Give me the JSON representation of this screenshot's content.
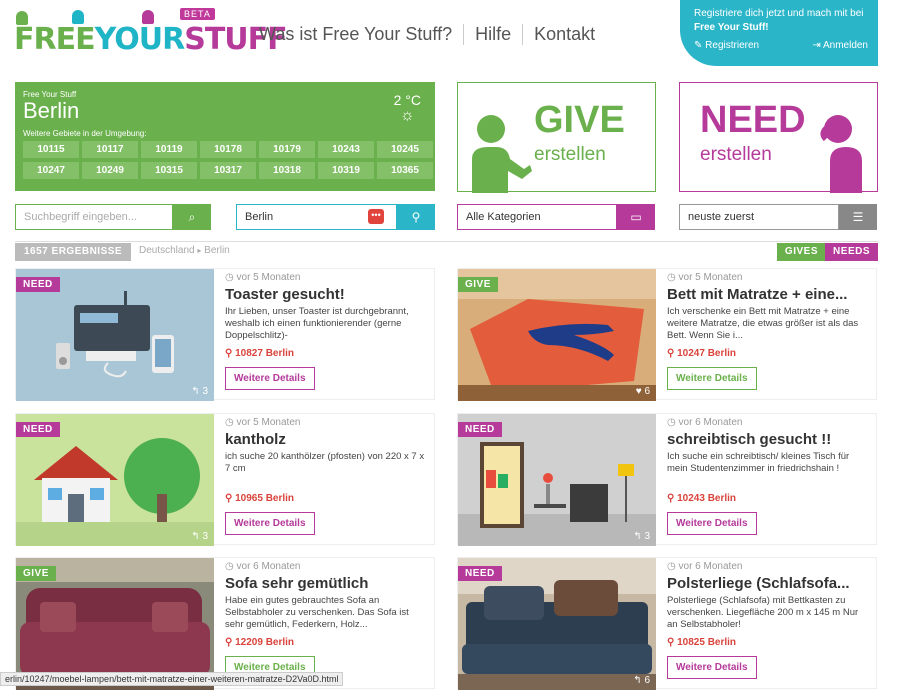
{
  "header": {
    "logo_text": "FREE YOUR STUFF",
    "logo_parts": [
      "FREE",
      "YOUR",
      "STUFF"
    ],
    "beta": "BETA",
    "nav": [
      "Was ist Free Your Stuff?",
      "Hilfe",
      "Kontakt"
    ],
    "register_line1": "Registriere dich jetzt und mach mit bei ",
    "register_brand": "Free Your Stuff!",
    "register_label": "Registrieren",
    "login_label": "Anmelden"
  },
  "city": {
    "brand": "Free Your Stuff",
    "name": "Berlin",
    "temperature": "2 °C",
    "nearby_label": "Weitere Gebiete in der Umgebung:",
    "zips": [
      "10115",
      "10117",
      "10119",
      "10178",
      "10179",
      "10243",
      "10245",
      "10247",
      "10249",
      "10315",
      "10317",
      "10318",
      "10319",
      "10365"
    ]
  },
  "give": {
    "title": "GIVE",
    "sub": "erstellen"
  },
  "need": {
    "title": "NEED",
    "sub": "erstellen"
  },
  "filters": {
    "search_placeholder": "Suchbegriff eingeben...",
    "location_value": "Berlin",
    "category_value": "Alle Kategorien",
    "sort_value": "neuste zuerst"
  },
  "results": {
    "count": "1657 ERGEBNISSE",
    "breadcrumb": [
      "Deutschland",
      "Berlin"
    ],
    "toggle_gives": "GIVES",
    "toggle_needs": "NEEDS"
  },
  "listings": [
    {
      "type": "NEED",
      "time": "vor 5 Monaten",
      "title": "Toaster gesucht!",
      "desc": "Ihr Lieben, unser Toaster ist durchgebrannt, weshalb ich einen funktionierender (gerne Doppelschlitz)-",
      "location": "10827 Berlin",
      "count": "3",
      "count_icon": "reply-icon",
      "button": "Weitere Details"
    },
    {
      "type": "GIVE",
      "time": "vor 5 Monaten",
      "title": "Bett mit Matratze + eine...",
      "desc": "Ich verschenke ein Bett mit Matratze + eine weitere Matratze, die etwas größer ist als das Bett. Wenn Sie i...",
      "location": "10247 Berlin",
      "count": "6",
      "count_icon": "heart-icon",
      "button": "Weitere Details"
    },
    {
      "type": "NEED",
      "time": "vor 5 Monaten",
      "title": "kantholz",
      "desc": "ich suche 20 kanthölzer (pfosten) von 220 x 7 x 7 cm",
      "location": "10965 Berlin",
      "count": "3",
      "count_icon": "reply-icon",
      "button": "Weitere Details"
    },
    {
      "type": "NEED",
      "time": "vor 6 Monaten",
      "title": "schreibtisch gesucht !!",
      "desc": "Ich suche ein schreibtisch/ kleines Tisch für mein Studentenzimmer in friedrichshain !",
      "location": "10243 Berlin",
      "count": "3",
      "count_icon": "reply-icon",
      "button": "Weitere Details"
    },
    {
      "type": "GIVE",
      "time": "vor 6 Monaten",
      "title": "Sofa sehr gemütlich",
      "desc": "Habe ein gutes gebrauchtes Sofa an Selbstabholer zu verschenken. Das Sofa ist sehr gemütlich, Federkern, Holz...",
      "location": "12209 Berlin",
      "count": "",
      "count_icon": "",
      "button": "Weitere Details"
    },
    {
      "type": "NEED",
      "time": "vor 6 Monaten",
      "title": "Polsterliege (Schlafsofa...",
      "desc": "Polsterliege (Schlafsofa) mit Bettkasten zu verschenken. Liegefläche 200 m x 145 m Nur an Selbstabholer!",
      "location": "10825 Berlin",
      "count": "6",
      "count_icon": "reply-icon",
      "button": "Weitere Details"
    }
  ],
  "status_url": "erlin/10247/moebel-lampen/bett-mit-matratze-einer-weiteren-matratze-D2Va0D.html",
  "colors": {
    "green": "#6ab04c",
    "purple": "#b53a9a",
    "teal": "#2bb5c8",
    "red": "#d9433c"
  }
}
